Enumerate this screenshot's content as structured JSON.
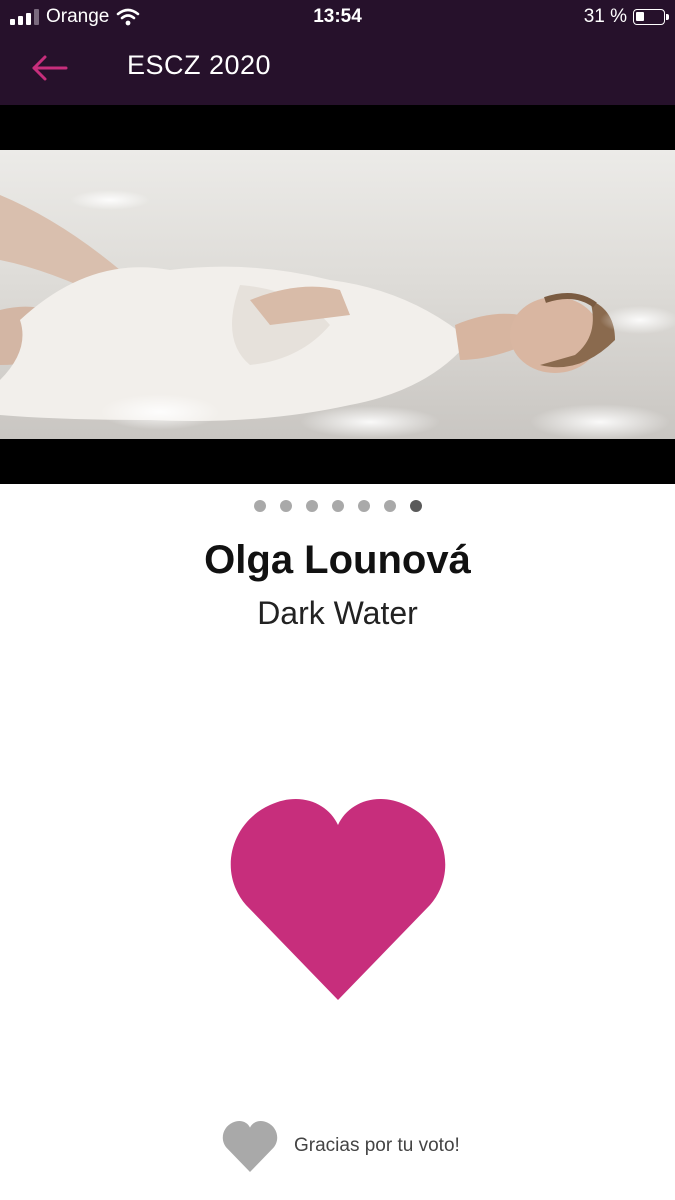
{
  "status_bar": {
    "carrier": "Orange",
    "time": "13:54",
    "battery_percent": "31 %",
    "battery_level": 0.31,
    "icons": [
      "signal-icon",
      "wifi-icon",
      "battery-icon"
    ]
  },
  "app_bar": {
    "title": "ESCZ 2020",
    "back_icon": "arrow-left-icon"
  },
  "carousel": {
    "page_count": 7,
    "current_page": 7
  },
  "entry": {
    "artist": "Olga Lounová",
    "song": "Dark Water"
  },
  "vote": {
    "heart_icon": "heart-icon",
    "message": "Gracias por tu voto!"
  },
  "colors": {
    "header_bg": "#26112b",
    "accent": "#c72e7c",
    "muted": "#a9a9a9"
  }
}
